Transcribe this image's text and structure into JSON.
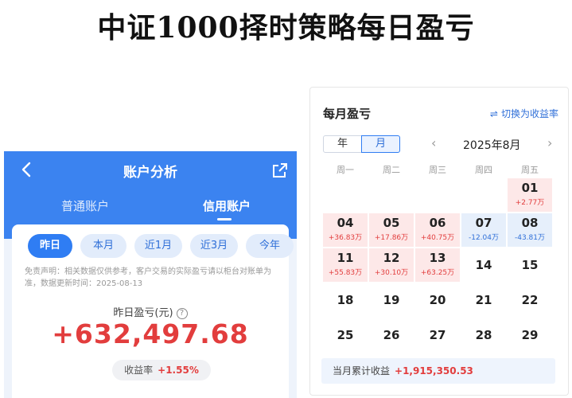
{
  "headline": "中证1000择时策略每日盈亏",
  "account_screen": {
    "title": "账户分析",
    "tabs": [
      "普通账户",
      "信用账户"
    ],
    "periods": [
      "昨日",
      "本月",
      "近1月",
      "近3月",
      "今年"
    ],
    "disclaimer": "免责声明：相关数据仅供参考，客户交易的实际盈亏请以柜台对账单为准，数据更新时间：2025-08-13",
    "pnl_label": "昨日盈亏(元)",
    "help_glyph": "?",
    "pnl_value": "+632,497.68",
    "rate_label": "收益率",
    "rate_value": "+1.55%"
  },
  "calendar": {
    "title": "每月盈亏",
    "switch_label": "切换为收益率",
    "swap_glyph": "⇌",
    "view_year": "年",
    "view_month": "月",
    "month_label": "2025年8月",
    "prev_glyph": "‹",
    "next_glyph": "›",
    "weekdays": [
      "周一",
      "周二",
      "周三",
      "周四",
      "周五"
    ],
    "days": [
      {
        "day": "01",
        "value": "+2.77万",
        "tone": "pos"
      },
      {
        "day": "04",
        "value": "+36.83万",
        "tone": "pos"
      },
      {
        "day": "05",
        "value": "+17.86万",
        "tone": "pos"
      },
      {
        "day": "06",
        "value": "+40.75万",
        "tone": "pos"
      },
      {
        "day": "07",
        "value": "-12.04万",
        "tone": "neg"
      },
      {
        "day": "08",
        "value": "-43.81万",
        "tone": "neg"
      },
      {
        "day": "11",
        "value": "+55.83万",
        "tone": "pos"
      },
      {
        "day": "12",
        "value": "+30.10万",
        "tone": "pos"
      },
      {
        "day": "13",
        "value": "+63.25万",
        "tone": "pos"
      },
      {
        "day": "14",
        "value": "",
        "tone": "plain"
      },
      {
        "day": "15",
        "value": "",
        "tone": "plain"
      },
      {
        "day": "18",
        "value": "",
        "tone": "plain"
      },
      {
        "day": "19",
        "value": "",
        "tone": "plain"
      },
      {
        "day": "20",
        "value": "",
        "tone": "plain"
      },
      {
        "day": "21",
        "value": "",
        "tone": "plain"
      },
      {
        "day": "22",
        "value": "",
        "tone": "plain"
      },
      {
        "day": "25",
        "value": "",
        "tone": "plain"
      },
      {
        "day": "26",
        "value": "",
        "tone": "plain"
      },
      {
        "day": "27",
        "value": "",
        "tone": "plain"
      },
      {
        "day": "28",
        "value": "",
        "tone": "plain"
      },
      {
        "day": "29",
        "value": "",
        "tone": "plain"
      }
    ],
    "summary_label": "当月累计收益",
    "summary_value": "+1,915,350.53"
  },
  "colors": {
    "brand_blue": "#3b83f0",
    "gain_red": "#e23d3d",
    "loss_blue": "#2f6fd8"
  }
}
